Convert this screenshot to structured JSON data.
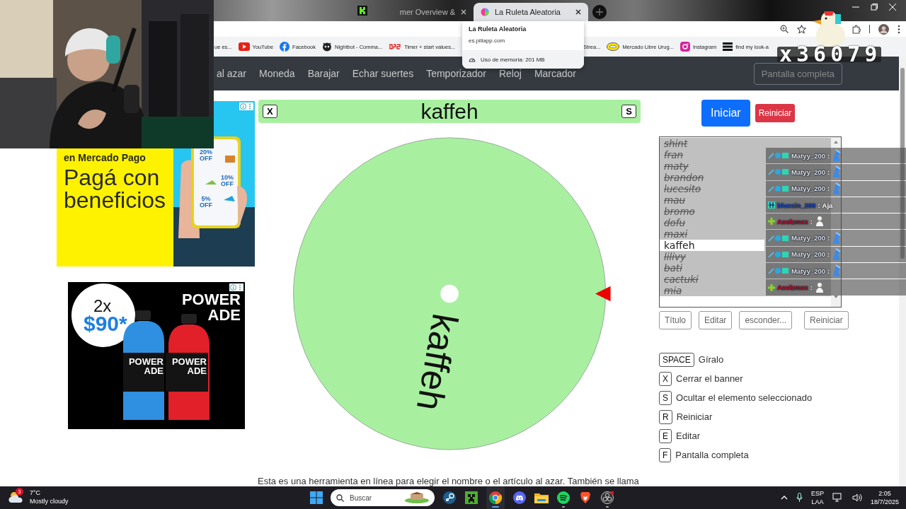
{
  "browser": {
    "tabs": [
      {
        "title": "mer Overview &",
        "selected": false
      },
      {
        "title": "La Ruleta Aleatoria",
        "selected": true
      }
    ],
    "tab_preview": {
      "title": "La Ruleta Aleatoria",
      "url": "es.piliapp.com",
      "memory": "Uso de memoria: 201 MB"
    },
    "bookmarks": [
      {
        "kind": "page",
        "label": "ue es..."
      },
      {
        "kind": "youtube",
        "label": "YouTube"
      },
      {
        "kind": "facebook",
        "label": "Facebook"
      },
      {
        "kind": "bot",
        "label": "Nightbot - Comma..."
      },
      {
        "kind": "dps",
        "label": "Timer + start values..."
      },
      {
        "kind": "text",
        "label": "Strea..."
      },
      {
        "kind": "mercado",
        "label": "Mercado Libre Urug..."
      },
      {
        "kind": "instagram",
        "label": "Instagram"
      },
      {
        "kind": "list",
        "label": "find my look-a"
      }
    ]
  },
  "site_nav": {
    "items": [
      "al azar",
      "Moneda",
      "Barajar",
      "Echar suertes",
      "Temporizador",
      "Reloj",
      "Marcador"
    ],
    "fullscreen": "Pantalla completa"
  },
  "ads": [
    {
      "kind": "mercado",
      "headline": "en Mercado Pago",
      "title": "Pagá con beneficios",
      "offers": [
        "20% OFF",
        "10% OFF",
        "5% OFF"
      ]
    },
    {
      "kind": "powerade",
      "amount": "2x",
      "price": "$90*",
      "brand": "POWER ADE",
      "bottles": [
        "POWER ADE",
        "POWER ADE"
      ]
    }
  ],
  "banner": {
    "title": "kaffeh",
    "keys": [
      "X",
      "S"
    ]
  },
  "wheel": {
    "label": "kaffeh"
  },
  "controls": {
    "start": "Iniciar",
    "reset": "Reiniciar"
  },
  "list": {
    "items": [
      {
        "name": "shint",
        "hidden": true,
        "selected": false
      },
      {
        "name": "fran",
        "hidden": true,
        "selected": false
      },
      {
        "name": "maty",
        "hidden": true,
        "selected": false
      },
      {
        "name": "brandon",
        "hidden": true,
        "selected": false
      },
      {
        "name": "lucesito",
        "hidden": true,
        "selected": false
      },
      {
        "name": "mau",
        "hidden": true,
        "selected": false
      },
      {
        "name": "bromo",
        "hidden": true,
        "selected": false
      },
      {
        "name": "dofu",
        "hidden": true,
        "selected": false
      },
      {
        "name": "maxi",
        "hidden": true,
        "selected": false
      },
      {
        "name": "kaffeh",
        "hidden": false,
        "selected": true
      },
      {
        "name": "lilivy",
        "hidden": true,
        "selected": false
      },
      {
        "name": "bati",
        "hidden": true,
        "selected": false
      },
      {
        "name": "cactuki",
        "hidden": true,
        "selected": false
      },
      {
        "name": "mia",
        "hidden": true,
        "selected": false
      }
    ]
  },
  "list_buttons": [
    "Título",
    "Editar",
    "esconder...",
    "Reiniciar"
  ],
  "shortcuts": [
    {
      "key": "SPACE",
      "label": "Gíralo"
    },
    {
      "key": "X",
      "label": "Cerrar el banner"
    },
    {
      "key": "S",
      "label": "Ocultar el elemento seleccionado"
    },
    {
      "key": "R",
      "label": "Reiniciar"
    },
    {
      "key": "E",
      "label": "Editar"
    },
    {
      "key": "F",
      "label": "Pantalla completa"
    }
  ],
  "intro_text": "Esta es una herramienta en línea para elegir el nombre o el artículo al azar. También se llama",
  "chat": [
    {
      "kind": "bird",
      "user": "Matyy_200",
      "separator": ":",
      "color": "#dfe7f7"
    },
    {
      "kind": "bird",
      "user": "Matyy_200",
      "separator": ":",
      "color": "#dfe7f7"
    },
    {
      "kind": "bird",
      "user": "Matyy_200",
      "separator": ":",
      "color": "#dfe7f7"
    },
    {
      "kind": "text",
      "user": "bluecin_200",
      "separator": ":",
      "color": "#1f4fd0",
      "text": "Aja"
    },
    {
      "kind": "duck",
      "user": "Axelzmxx",
      "separator": ":",
      "color": "#c0103a"
    },
    {
      "kind": "bird",
      "user": "Matyy_200",
      "separator": ":",
      "color": "#dfe7f7"
    },
    {
      "kind": "bird",
      "user": "Matyy_200",
      "separator": ":",
      "color": "#dfe7f7"
    },
    {
      "kind": "bird",
      "user": "Matyy_200",
      "separator": ":",
      "color": "#dfe7f7"
    },
    {
      "kind": "duck",
      "user": "Axelzmxx",
      "separator": ":",
      "color": "#c0103a"
    }
  ],
  "stream": {
    "counter": "x36079"
  },
  "taskbar": {
    "weather": {
      "temp": "7°C",
      "desc": "Mostly cloudy",
      "badge": "3"
    },
    "search_placeholder": "Buscar",
    "apps": [
      {
        "kind": "steam",
        "active": false,
        "running": false
      },
      {
        "kind": "minecraft",
        "active": false,
        "running": false
      },
      {
        "kind": "chrome",
        "active": true,
        "running": true
      },
      {
        "kind": "discord",
        "active": false,
        "running": false
      },
      {
        "kind": "files",
        "active": false,
        "running": false
      },
      {
        "kind": "spotify",
        "active": false,
        "running": true
      },
      {
        "kind": "brave",
        "active": false,
        "running": false
      },
      {
        "kind": "obs",
        "active": false,
        "running": true
      }
    ],
    "lang": [
      "ESP",
      "LAA"
    ],
    "time": "2:05",
    "date": "18/7/2025"
  }
}
